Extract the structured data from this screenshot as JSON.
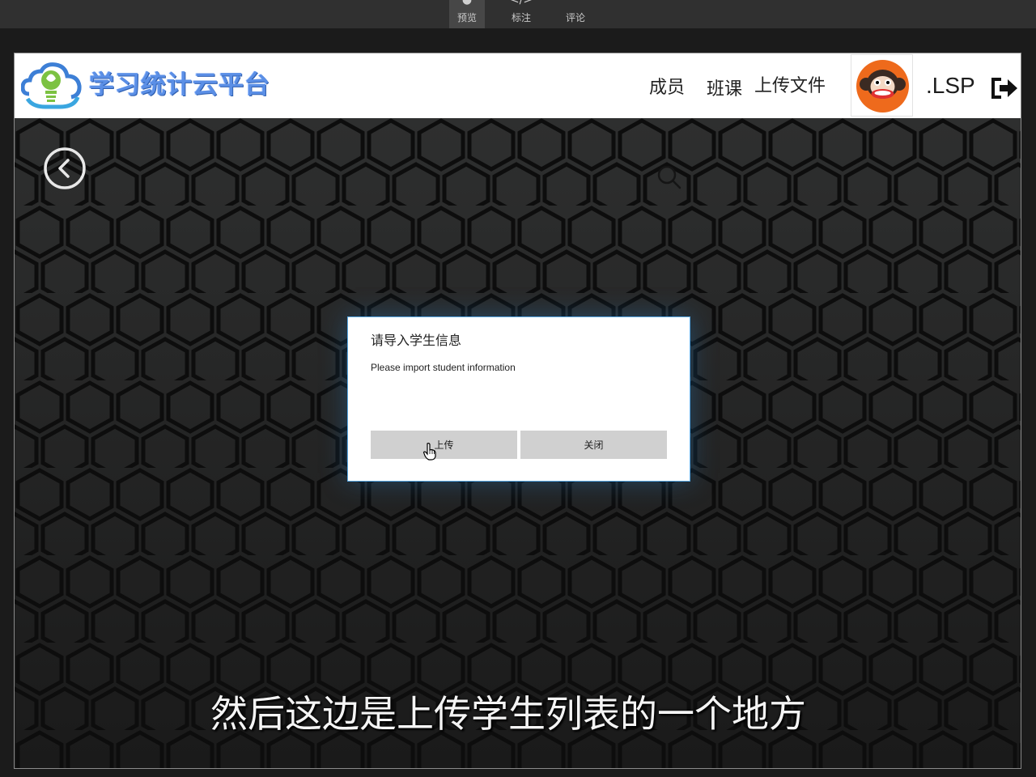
{
  "toolbar": {
    "items": [
      {
        "label": "预览",
        "icon": "eye-icon",
        "active": true
      },
      {
        "label": "标注",
        "icon": "code-icon",
        "active": false
      },
      {
        "label": "评论",
        "icon": "comment-icon",
        "active": false
      }
    ]
  },
  "header": {
    "brand": "学习统计云平台",
    "nav": {
      "members": "成员",
      "classes": "班课",
      "upload_file": "上传文件"
    },
    "username": ".LSP",
    "avatar_icon": "monkey-avatar-icon",
    "logout_icon": "logout-icon"
  },
  "dialog": {
    "title": "请导入学生信息",
    "message": "Please import student information",
    "upload_label": "上传",
    "close_label": "关闭"
  },
  "subtitle": "然后这边是上传学生列表的一个地方",
  "colors": {
    "brand": "#5b8fe6",
    "dialog_border": "#59a9e6",
    "avatar_bg": "#ee6a1c",
    "button_bg": "#d0d0d0"
  }
}
